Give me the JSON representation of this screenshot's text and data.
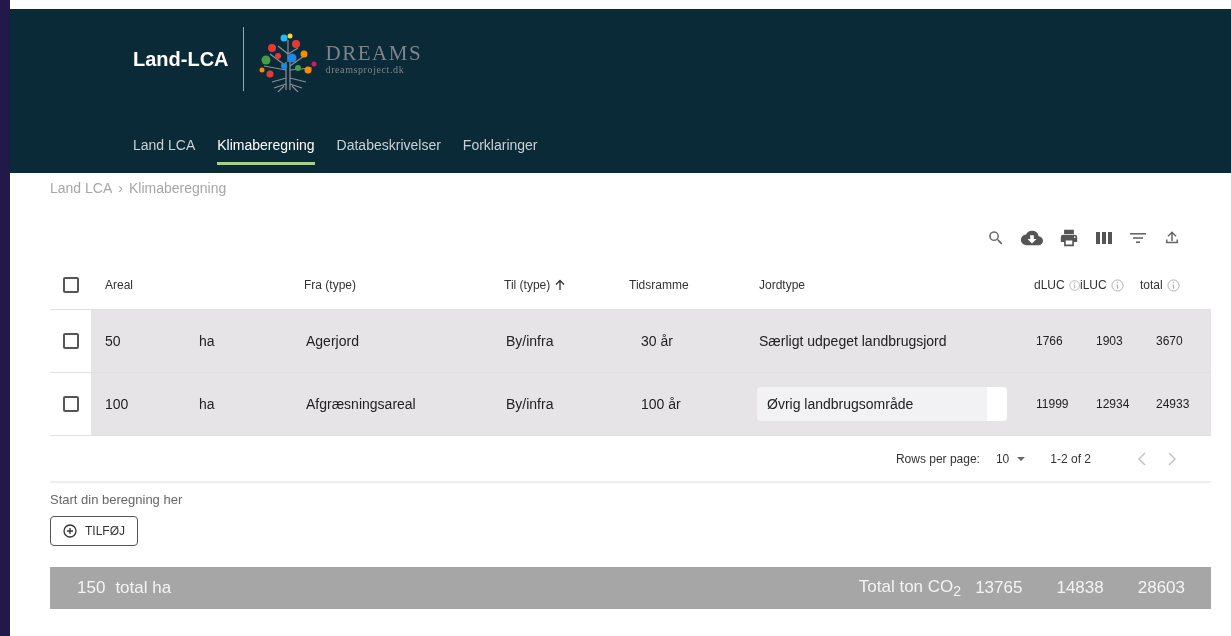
{
  "app": {
    "title": "Land-LCA",
    "logo_name": "DREAMS",
    "logo_url": "dreamsproject.dk"
  },
  "tabs": [
    {
      "label": "Land LCA",
      "selected": false
    },
    {
      "label": "Klimaberegning",
      "selected": true
    },
    {
      "label": "Databeskrivelser",
      "selected": false
    },
    {
      "label": "Forklaringer",
      "selected": false
    }
  ],
  "breadcrumb": {
    "items": [
      "Land LCA",
      "Klimaberegning"
    ],
    "separator": "›"
  },
  "table": {
    "select_all_checked": false,
    "columns": [
      {
        "label": "Areal",
        "kind": "wide",
        "sorted": false,
        "info": false
      },
      {
        "label": "Fra (type)",
        "kind": "plain",
        "sorted": false,
        "info": false
      },
      {
        "label": "Til (type)",
        "kind": "plain",
        "sorted": true,
        "info": false
      },
      {
        "label": "Tidsramme",
        "kind": "plain",
        "sorted": false,
        "info": false
      },
      {
        "label": "Jordtype",
        "kind": "plain",
        "sorted": false,
        "info": false
      },
      {
        "label": "dLUC",
        "kind": "number",
        "sorted": false,
        "info": true
      },
      {
        "label": "iLUC",
        "kind": "number",
        "sorted": false,
        "info": true
      },
      {
        "label": "total",
        "kind": "number",
        "sorted": false,
        "info": true
      }
    ],
    "rows": [
      {
        "checked": false,
        "areal": "50",
        "unit": "ha",
        "fra": "Agerjord",
        "til": "By/infra",
        "tidsramme": "30 år",
        "jordtype": {
          "kind": "text",
          "value": "Særligt udpeget landbrugsjord"
        },
        "dluc": "1766",
        "iluc": "1903",
        "total": "3670"
      },
      {
        "checked": false,
        "areal": "100",
        "unit": "ha",
        "fra": "Afgræsningsareal",
        "til": "By/infra",
        "tidsramme": "100 år",
        "jordtype": {
          "kind": "field",
          "value": "Øvrig landbrugsområde"
        },
        "dluc": "11999",
        "iluc": "12934",
        "total": "24933"
      }
    ],
    "pagination": {
      "rows_per_page_label": "Rows per page:",
      "rows_per_page": "10",
      "range": "1-2 of 2",
      "prev_disabled": true,
      "next_disabled": true
    }
  },
  "start": {
    "hint": "Start din beregning her",
    "add_button": "TILFØJ"
  },
  "totals": {
    "area": "150",
    "area_label": "total ha",
    "co2_label": "Total ton CO$_{2}$",
    "dluc": "13765",
    "iluc": "14838",
    "total": "28603"
  }
}
